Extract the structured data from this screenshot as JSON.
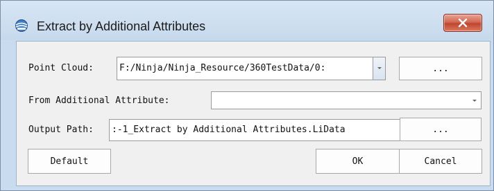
{
  "window": {
    "title": "Extract by Additional Attributes",
    "icon": "app-globe-icon",
    "close_icon": "close-icon",
    "accent_close": "#c1442f"
  },
  "form": {
    "point_cloud": {
      "label": "Point Cloud:",
      "value": "F:/Ninja/Ninja_Resource/360TestData/0:",
      "browse_label": "..."
    },
    "additional_attribute": {
      "label": "From Additional Attribute:",
      "value": ""
    },
    "output_path": {
      "label": "Output Path:",
      "value": ":-1_Extract by Additional Attributes.LiData",
      "browse_label": "..."
    }
  },
  "buttons": {
    "default_label": "Default",
    "ok_label": "OK",
    "cancel_label": "Cancel"
  }
}
